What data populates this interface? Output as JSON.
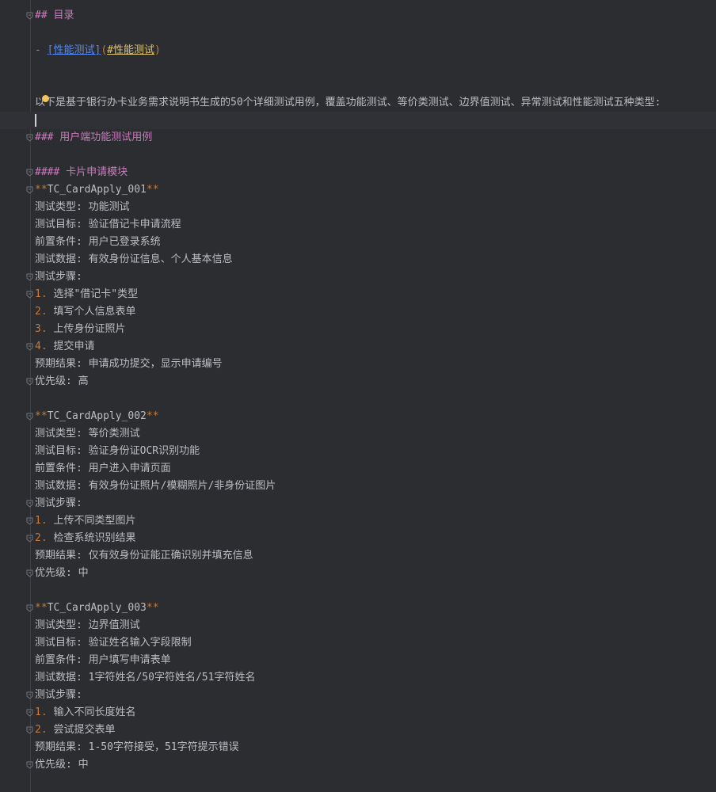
{
  "toc": {
    "heading": "## 目录",
    "item_dash": "- ",
    "item_text": "[性能测试]",
    "item_open": "(",
    "item_url": "#性能测试",
    "item_close": ")"
  },
  "intro": "以下是基于银行办卡业务需求说明书生成的50个详细测试用例，覆盖功能测试、等价类测试、边界值测试、异常测试和性能测试五种类型:",
  "section_heading": "### 用户端功能测试用例",
  "module_heading": "#### 卡片申请模块",
  "cases": [
    {
      "id": "TC_CardApply_001",
      "type": "测试类型: 功能测试",
      "goal": "测试目标: 验证借记卡申请流程",
      "pre": "前置条件: 用户已登录系统",
      "data": "测试数据: 有效身份证信息、个人基本信息",
      "steps_label": "测试步骤:",
      "steps": [
        {
          "n": "1.",
          "t": "选择\"借记卡\"类型"
        },
        {
          "n": "2.",
          "t": "填写个人信息表单"
        },
        {
          "n": "3.",
          "t": "上传身份证照片"
        },
        {
          "n": "4.",
          "t": "提交申请"
        }
      ],
      "expected": "预期结果: 申请成功提交，显示申请编号",
      "priority": "优先级: 高"
    },
    {
      "id": "TC_CardApply_002",
      "type": "测试类型: 等价类测试",
      "goal": "测试目标: 验证身份证OCR识别功能",
      "pre": "前置条件: 用户进入申请页面",
      "data": "测试数据: 有效身份证照片/模糊照片/非身份证图片",
      "steps_label": "测试步骤:",
      "steps": [
        {
          "n": "1.",
          "t": "上传不同类型图片"
        },
        {
          "n": "2.",
          "t": "检查系统识别结果"
        }
      ],
      "expected": "预期结果: 仅有效身份证能正确识别并填充信息",
      "priority": "优先级: 中"
    },
    {
      "id": "TC_CardApply_003",
      "type": "测试类型: 边界值测试",
      "goal": "测试目标: 验证姓名输入字段限制",
      "pre": "前置条件: 用户填写申请表单",
      "data": "测试数据: 1字符姓名/50字符姓名/51字符姓名",
      "steps_label": "测试步骤:",
      "steps": [
        {
          "n": "1.",
          "t": "输入不同长度姓名"
        },
        {
          "n": "2.",
          "t": "尝试提交表单"
        }
      ],
      "expected": "预期结果: 1-50字符接受，51字符提示错误",
      "priority": "优先级: 中"
    }
  ],
  "colors": {
    "background": "#2b2d30",
    "text": "#bcbec4",
    "heading": "#c77dbb",
    "markup": "#cc7832",
    "link": "#548af7",
    "url": "#e0c46c"
  }
}
